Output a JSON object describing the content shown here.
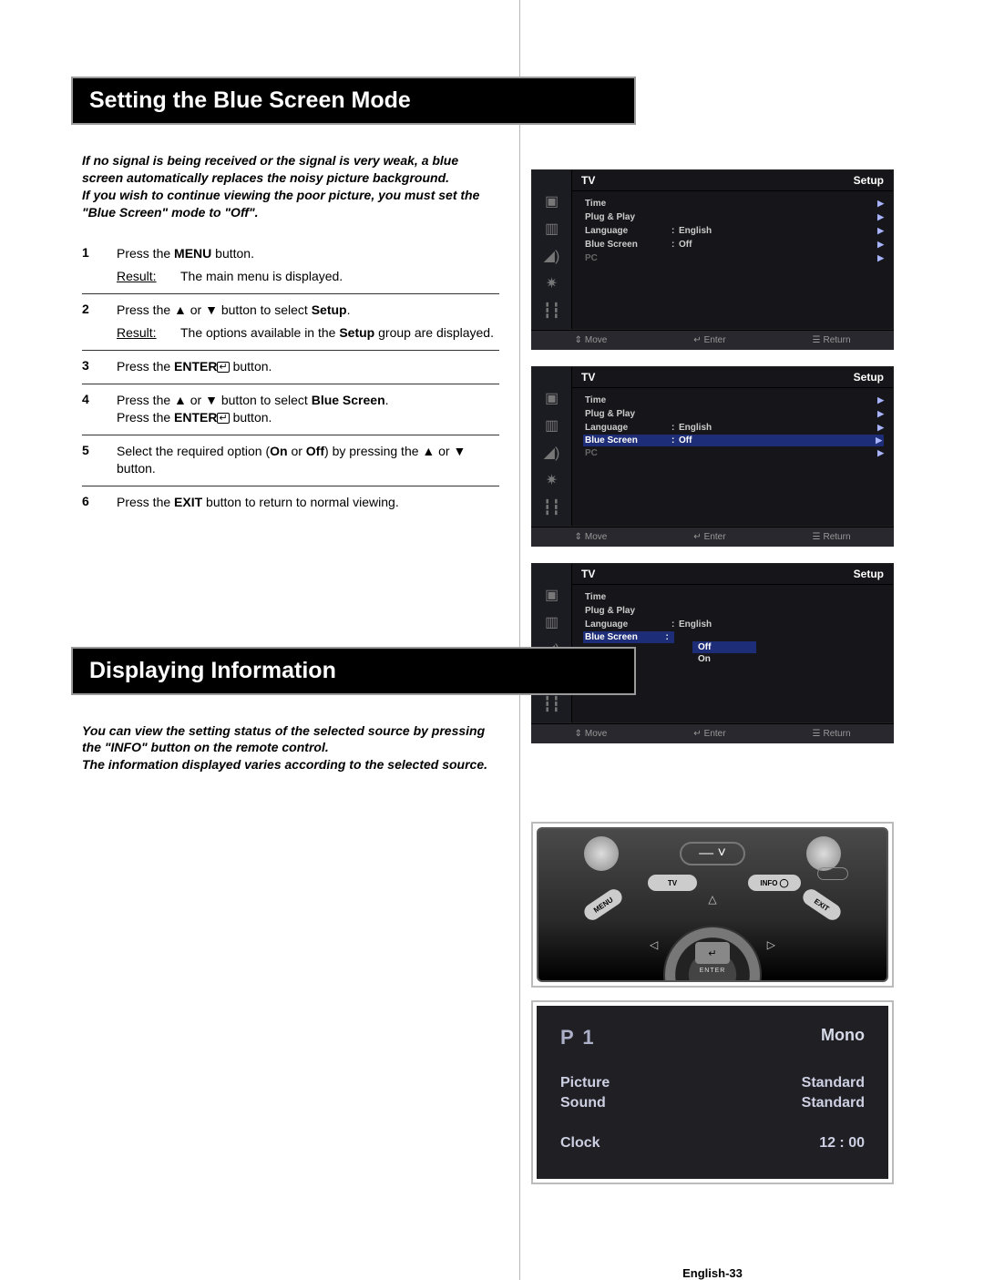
{
  "section1": {
    "title": "Setting the Blue Screen Mode",
    "intro": "If no signal is being received or the signal is very weak, a blue screen automatically replaces the noisy picture background.\nIf you wish to continue viewing the poor picture, you must set the \"Blue Screen\" mode to \"Off\".",
    "steps": {
      "s1a": "Press the ",
      "s1b": "MENU",
      "s1c": " button.",
      "s1_result": "Result:",
      "s1_result_body": "The main menu is displayed.",
      "s2a": "Press the ▲ or ▼ button to select ",
      "s2b": "Setup",
      "s2c": ".",
      "s2_result": "Result:",
      "s2_result_body_a": "The options available in the ",
      "s2_result_body_b": "Setup",
      "s2_result_body_c": " group are displayed.",
      "s3a": "Press the ",
      "s3b": "ENTER",
      "s3c": " button.",
      "s4a": "Press the ▲ or ▼ button to select ",
      "s4b": "Blue Screen",
      "s4c": ".",
      "s4d": "Press the ",
      "s4e": "ENTER",
      "s4f": " button.",
      "s5a": "Select the required option (",
      "s5b": "On",
      "s5c": " or ",
      "s5d": "Off",
      "s5e": ") by pressing the ▲ or ▼ button.",
      "s6a": "Press the ",
      "s6b": "EXIT",
      "s6c": " button to return to normal viewing."
    }
  },
  "osd": {
    "hdr_left": "TV",
    "hdr_right": "Setup",
    "items": {
      "time": "Time",
      "plug": "Plug & Play",
      "lang": "Language",
      "lang_val": "English",
      "blue": "Blue Screen",
      "blue_val": "Off",
      "pc": "PC"
    },
    "dropdown": {
      "off": "Off",
      "on": "On"
    },
    "footer": {
      "move": "Move",
      "enter": "Enter",
      "return": "Return"
    }
  },
  "section2": {
    "title": "Displaying Information",
    "intro_a": "You can view the setting status of the selected source by pressing the \"",
    "intro_b": "INFO",
    "intro_c": "\" button on the remote control.\nThe information displayed varies according to the selected source."
  },
  "remote": {
    "tv": "TV",
    "info": "INFO",
    "menu": "MENU",
    "exit": "EXIT",
    "enter": "↵",
    "enter_label": "ENTER"
  },
  "info_display": {
    "program": "P 1",
    "mono": "Mono",
    "picture_l": "Picture",
    "picture_v": "Standard",
    "sound_l": "Sound",
    "sound_v": "Standard",
    "clock_l": "Clock",
    "clock_v": "12 : 00"
  },
  "footer": "English-33"
}
